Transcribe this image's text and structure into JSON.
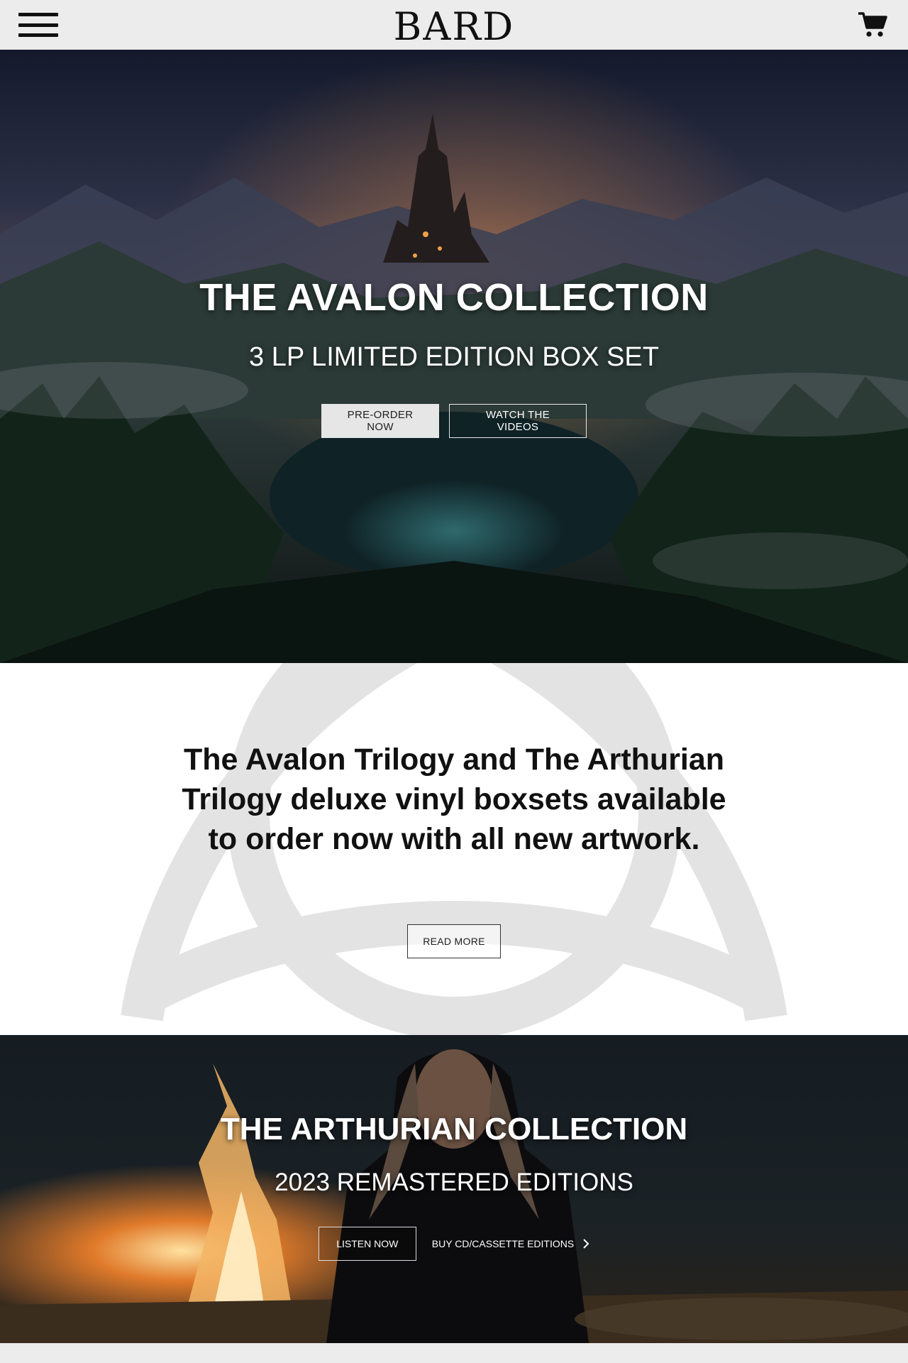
{
  "header": {
    "logo_text": "BARD",
    "menu_icon": "hamburger-menu-icon",
    "cart_icon": "shopping-cart-icon"
  },
  "hero": {
    "title": "THE AVALON COLLECTION",
    "subtitle": "3 LP LIMITED EDITION BOX SET",
    "primary_button": "PRE-ORDER NOW",
    "secondary_button": "WATCH THE  VIDEOS"
  },
  "promo": {
    "text": "The Avalon Trilogy and The Arthurian Trilogy deluxe vinyl boxsets available to order now with all new artwork.",
    "button": "READ MORE"
  },
  "hero2": {
    "title": "THE ARTHURIAN COLLECTION",
    "subtitle": "2023 REMASTERED EDITIONS",
    "listen_button": "LISTEN NOW",
    "buy_link": "BUY CD/CASSETTE EDITIONS"
  },
  "colors": {
    "header_bg": "#ececec",
    "text_dark": "#111111",
    "button_light": "#e6e6e6"
  }
}
